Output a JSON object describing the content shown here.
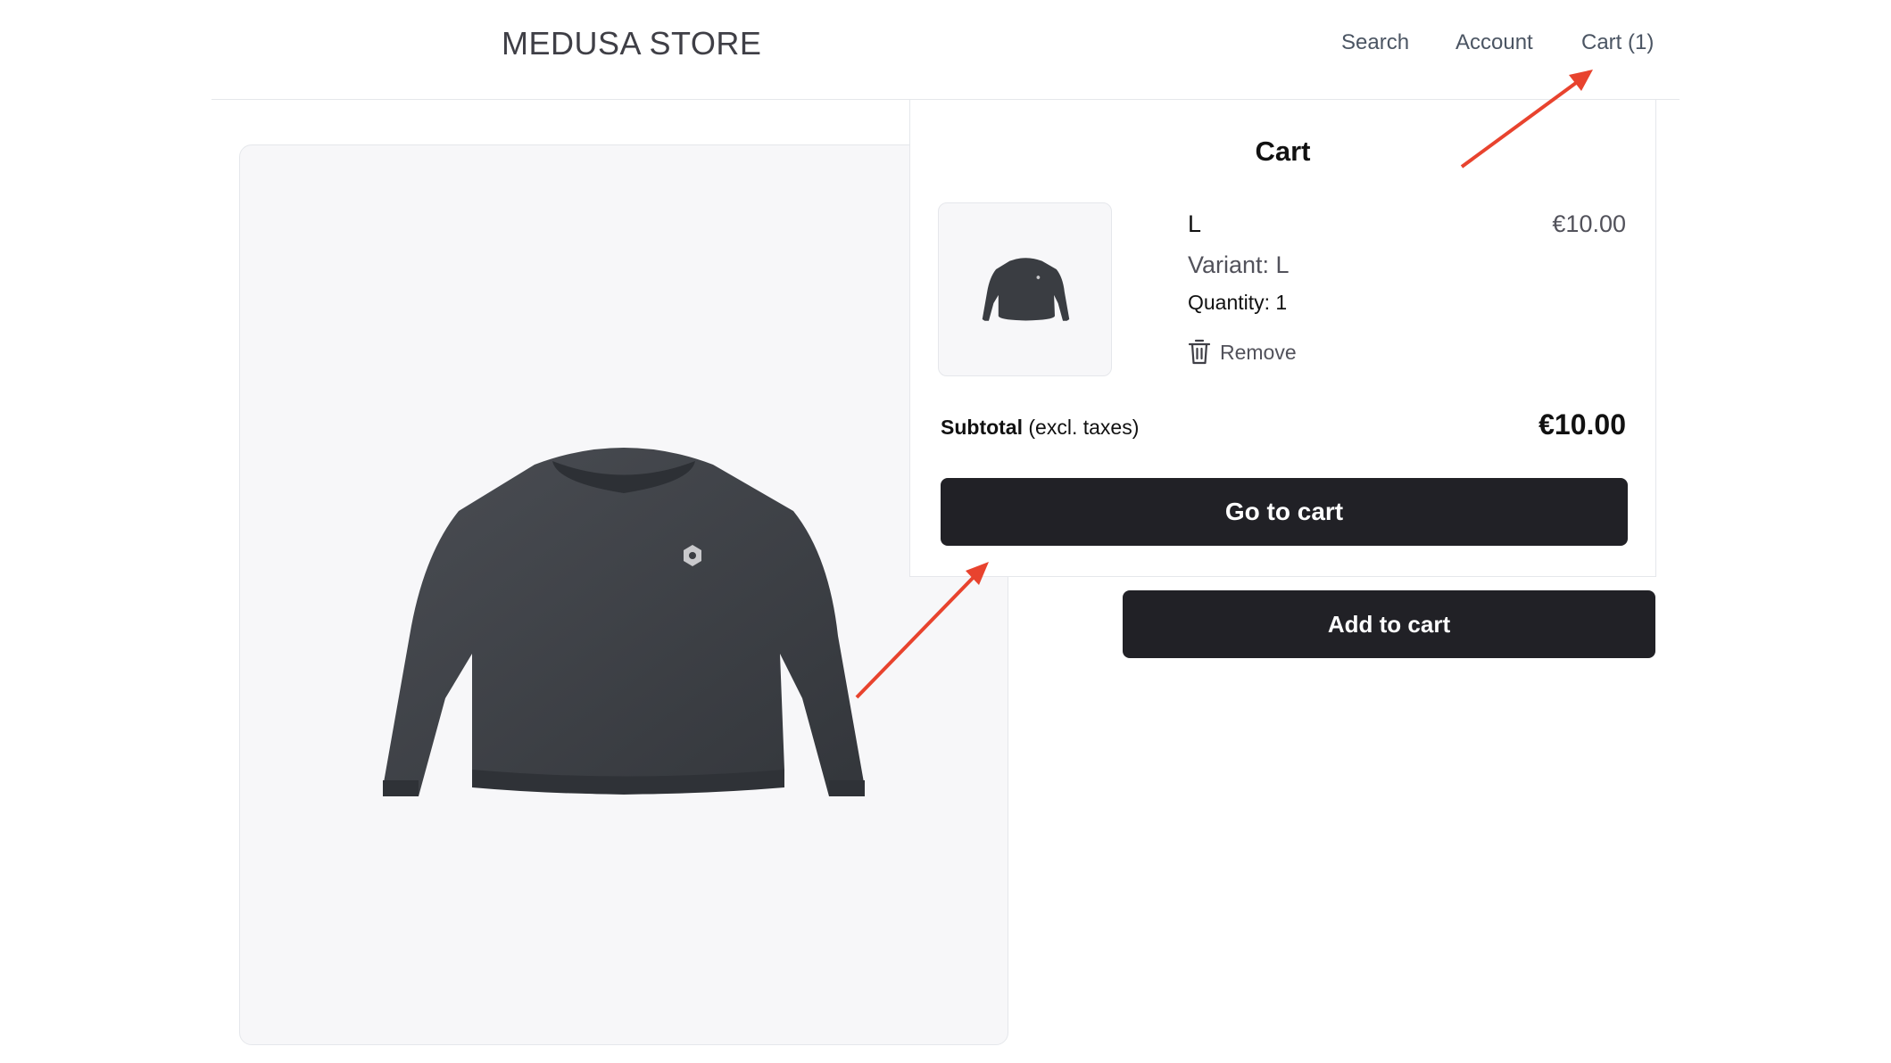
{
  "header": {
    "brand": "MEDUSA STORE",
    "nav": {
      "search": "Search",
      "account": "Account",
      "cart": "Cart (1)"
    }
  },
  "product": {
    "add_to_cart_label": "Add to cart"
  },
  "cart_dropdown": {
    "title": "Cart",
    "item": {
      "name": "L",
      "price": "€10.00",
      "variant": "Variant: L",
      "quantity": "Quantity: 1",
      "remove_label": "Remove",
      "icon": "trash-icon"
    },
    "subtotal_label": "Subtotal",
    "subtotal_note": " (excl. taxes)",
    "subtotal_value": "€10.00",
    "go_to_cart_label": "Go to cart"
  },
  "colors": {
    "button_bg": "#212126",
    "annotation_arrow": "#e8432e",
    "panel_bg": "#f7f7f9"
  }
}
